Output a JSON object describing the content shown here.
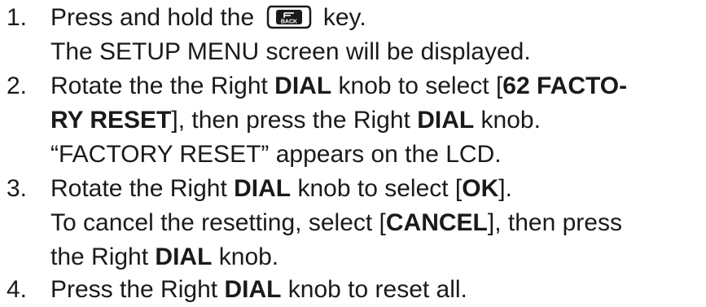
{
  "steps": [
    {
      "number": "1.",
      "lines": [
        {
          "pre": "Press and hold the",
          "post": "key."
        },
        {
          "text": "The SETUP MENU screen will be displayed."
        }
      ]
    },
    {
      "number": "2.",
      "lines": [
        {
          "a": "Rotate the the Right ",
          "b": "DIAL",
          "c": " knob to select [",
          "d": "62 FACTO-"
        },
        {
          "a": "RY RESET",
          "b": "], then press the Right ",
          "c": "DIAL",
          "d": " knob."
        },
        {
          "text": "“FACTORY RESET” appears on the LCD."
        }
      ]
    },
    {
      "number": "3.",
      "lines": [
        {
          "a": "Rotate the Right ",
          "b": "DIAL",
          "c": " knob to select [",
          "d": "OK",
          "e": "]."
        },
        {
          "a": "To cancel the resetting, select [",
          "b": "CANCEL",
          "c": "], then press"
        },
        {
          "a": "the Right ",
          "b": "DIAL",
          "c": " knob."
        }
      ]
    },
    {
      "number": "4.",
      "lines": [
        {
          "a": "Press the Right ",
          "b": "DIAL",
          "c": " knob to reset all."
        }
      ]
    }
  ],
  "back_key": {
    "icon": "back-key-icon",
    "label": "BACK"
  }
}
